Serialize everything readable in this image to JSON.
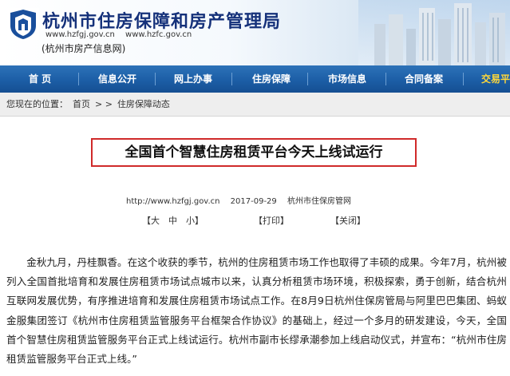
{
  "header": {
    "title": "杭州市住房保障和房产管理局",
    "url1": "www.hzfgj.gov.cn",
    "url2": "www.hzfc.gov.cn",
    "subname": "(杭州市房产信息网)"
  },
  "nav": {
    "items": [
      {
        "label": "首 页"
      },
      {
        "label": "信息公开"
      },
      {
        "label": "网上办事"
      },
      {
        "label": "住房保障"
      },
      {
        "label": "市场信息"
      },
      {
        "label": "合同备案"
      },
      {
        "label": "交易平"
      }
    ]
  },
  "breadcrumb": {
    "prefix": "您现在的位置：",
    "home": "首页",
    "sep": "> >",
    "current": "住房保障动态"
  },
  "article": {
    "title": "全国首个智慧住房租赁平台今天上线试运行",
    "meta_url": "http://www.hzfgj.gov.cn",
    "meta_date": "2017-09-29",
    "meta_source": "杭州市住保房管网",
    "font_sizes": "【大　中　小】",
    "print": "【打印】",
    "close": "【关闭】",
    "body": "　　金秋九月，丹桂飘香。在这个收获的季节，杭州的住房租赁市场工作也取得了丰硕的成果。今年7月，杭州被列入全国首批培育和发展住房租赁市场试点城市以来，认真分析租赁市场环境，积极探索，勇于创新，结合杭州互联网发展优势，有序推进培育和发展住房租赁市场试点工作。在8月9日杭州住保房管局与阿里巴巴集团、蚂蚁金服集团签订《杭州市住房租赁监管服务平台框架合作协议》的基础上，经过一个多月的研发建设，今天，全国首个智慧住房租赁监管服务平台正式上线试运行。杭州市副市长缪承潮参加上线启动仪式，并宣布：“杭州市住房租赁监管服务平台正式上线。”"
  },
  "colors": {
    "nav_bg": "#1c5ea6",
    "title_blue": "#15317a",
    "highlight_red": "#d02a2a",
    "nav_active": "#ffd83a"
  }
}
